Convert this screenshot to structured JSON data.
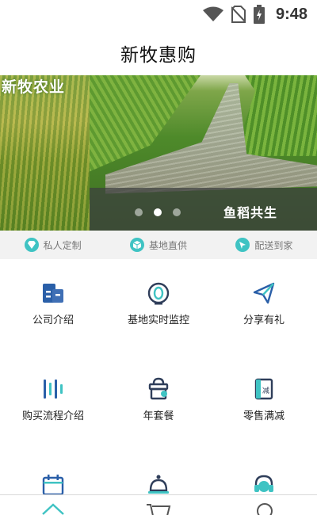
{
  "status_bar": {
    "time": "9:48",
    "icons": [
      "wifi-icon",
      "no-sim-icon",
      "battery-charging-icon"
    ]
  },
  "header": {
    "title": "新牧惠购"
  },
  "banner": {
    "brand_text": "新牧农业",
    "caption": "鱼稻共生",
    "slide_count": 3,
    "active_slide": 2
  },
  "features": [
    {
      "label": "私人定制",
      "icon": "diamond-icon"
    },
    {
      "label": "基地直供",
      "icon": "box-icon"
    },
    {
      "label": "配送到家",
      "icon": "delivery-icon"
    }
  ],
  "menu": [
    {
      "label": "公司介绍",
      "icon": "company-icon"
    },
    {
      "label": "基地实时监控",
      "icon": "monitor-eye-icon"
    },
    {
      "label": "分享有礼",
      "icon": "paper-plane-icon"
    },
    {
      "label": "购买流程介绍",
      "icon": "process-bars-icon"
    },
    {
      "label": "年套餐",
      "icon": "gift-basket-icon"
    },
    {
      "label": "零售满减",
      "icon": "discount-book-icon"
    },
    {
      "label": "",
      "icon": "calendar-icon"
    },
    {
      "label": "",
      "icon": "service-bell-icon"
    },
    {
      "label": "",
      "icon": "headset-icon"
    }
  ],
  "tab_bar": {
    "tabs": [
      {
        "icon": "home-icon"
      },
      {
        "icon": "cart-icon"
      },
      {
        "icon": "user-icon"
      }
    ]
  },
  "colors": {
    "accent_teal": "#3fc3c3",
    "icon_blue": "#2a5fa8",
    "icon_dark": "#2f3e5a"
  }
}
